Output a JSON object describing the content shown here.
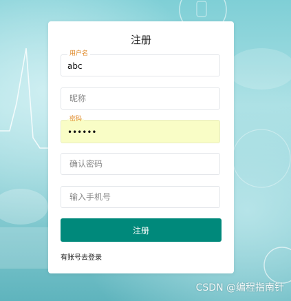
{
  "form": {
    "title": "注册",
    "username": {
      "label": "用户名",
      "value": "abc"
    },
    "nickname": {
      "placeholder": "昵称"
    },
    "password": {
      "label": "密码",
      "value": "abcdef"
    },
    "confirm_password": {
      "placeholder": "确认密码"
    },
    "phone": {
      "placeholder": "输入手机号"
    },
    "submit_label": "注册",
    "login_link": "有账号去登录"
  },
  "watermark": "CSDN @编程指南针",
  "colors": {
    "primary": "#00897b",
    "label_accent": "#e08a2a",
    "autofill_bg": "#f9fdc6"
  }
}
